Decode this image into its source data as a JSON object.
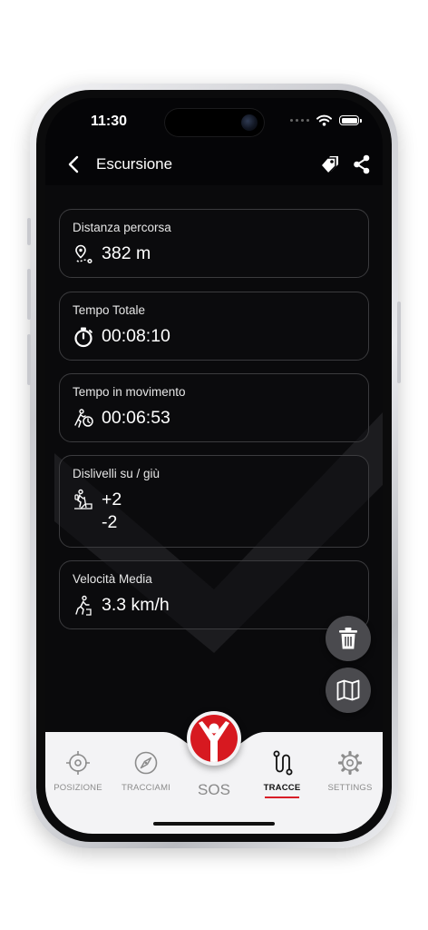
{
  "status_bar": {
    "time": "11:30"
  },
  "nav": {
    "title": "Escursione"
  },
  "cards": [
    {
      "label": "Distanza percorsa",
      "icon": "route-pin-icon",
      "value": "382 m"
    },
    {
      "label": "Tempo Totale",
      "icon": "stopwatch-icon",
      "value": "00:08:10"
    },
    {
      "label": "Tempo in movimento",
      "icon": "moving-time-icon",
      "value": "00:06:53"
    },
    {
      "label": "Dislivelli su / giù",
      "icon": "elevation-hiker-icon",
      "value_up": "+2",
      "value_down": "-2"
    },
    {
      "label": "Velocità Media",
      "icon": "walking-speed-icon",
      "value": "3.3 km/h"
    }
  ],
  "tabs": [
    {
      "label": "POSIZIONE",
      "icon": "crosshair-icon",
      "active": false
    },
    {
      "label": "TRACCIAMI",
      "icon": "compass-icon",
      "active": false
    },
    {
      "label": "SOS",
      "icon": "sos-person-icon",
      "active": false
    },
    {
      "label": "TRACCE",
      "icon": "track-path-icon",
      "active": true
    },
    {
      "label": "SETTINGS",
      "icon": "gear-icon",
      "active": false
    }
  ],
  "colors": {
    "accent": "#d71920",
    "background": "#0a0a0c",
    "card_border": "#3b3b3e",
    "fab": "#4a4a4e",
    "tabbar": "#f3f3f5"
  }
}
